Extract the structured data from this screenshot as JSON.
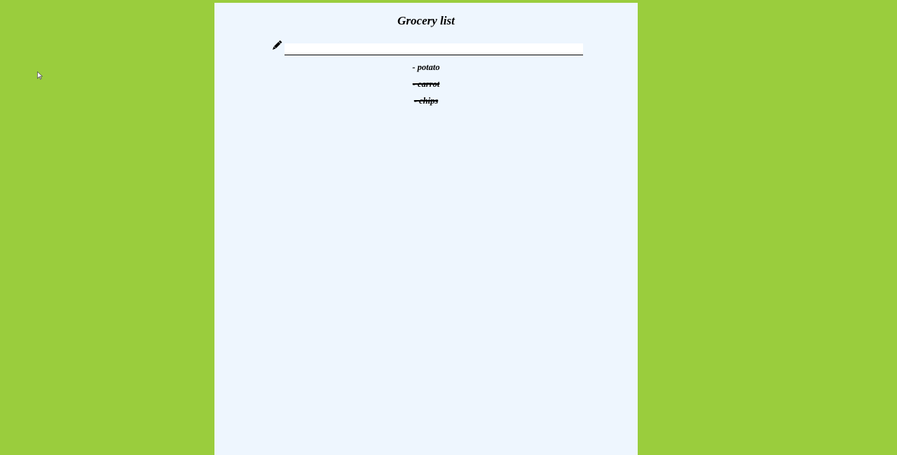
{
  "page": {
    "background_color": "#9acd3d",
    "panel_color": "#eef6fe"
  },
  "header": {
    "title": "Grocery list"
  },
  "entry": {
    "icon": "pencil-icon",
    "value": "",
    "placeholder": ""
  },
  "items": [
    {
      "label": "- potato",
      "completed": false
    },
    {
      "label": "- carrot",
      "completed": true
    },
    {
      "label": "- chips",
      "completed": true
    }
  ]
}
